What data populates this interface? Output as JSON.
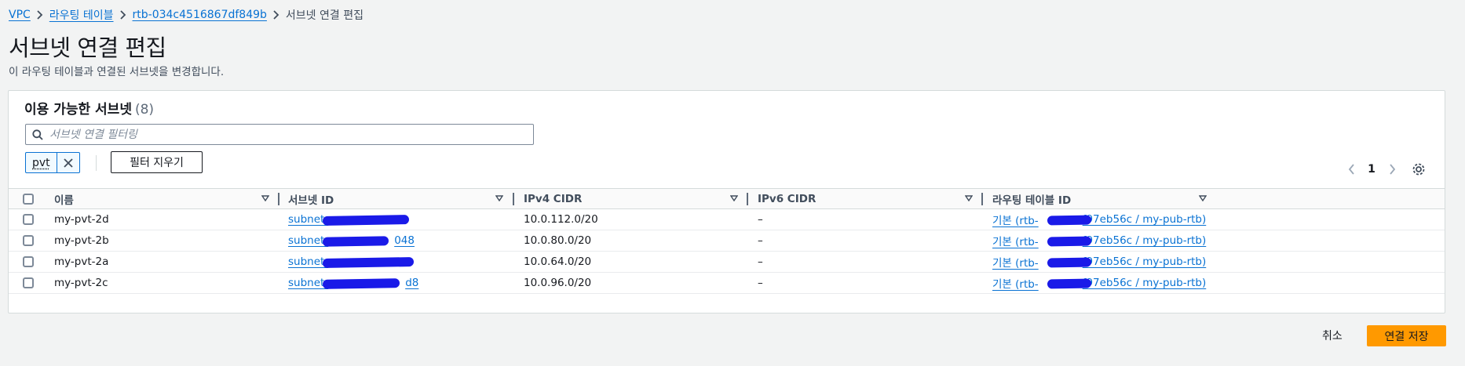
{
  "breadcrumb": {
    "items": [
      {
        "label": "VPC"
      },
      {
        "label": "라우팅 테이블"
      },
      {
        "label": "rtb-034c4516867df849b"
      }
    ],
    "current": "서브넷 연결 편집"
  },
  "page": {
    "title": "서브넷 연결 편집",
    "description": "이 라우팅 테이블과 연결된 서브넷을 변경합니다."
  },
  "panel": {
    "title": "이용 가능한 서브넷",
    "count": "(8)",
    "search_placeholder": "서브넷 연결 필터링",
    "filter_token": "pvt",
    "clear_filter_label": "필터 지우기",
    "current_page": "1"
  },
  "table": {
    "columns": [
      "이름",
      "서브넷 ID",
      "IPv4 CIDR",
      "IPv6 CIDR",
      "라우팅 테이블 ID"
    ],
    "rows": [
      {
        "name": "my-pvt-2d",
        "subnet_prefix": "subnet-",
        "subnet_suffix": "",
        "ipv4": "10.0.112.0/20",
        "ipv6": "–",
        "rtb_prefix": "기본 (rtb-",
        "rtb_suffix": "f97eb56c / my-pub-rtb)"
      },
      {
        "name": "my-pvt-2b",
        "subnet_prefix": "subnet-",
        "subnet_suffix": "048",
        "ipv4": "10.0.80.0/20",
        "ipv6": "–",
        "rtb_prefix": "기본 (rtb-",
        "rtb_suffix": "f97eb56c / my-pub-rtb)"
      },
      {
        "name": "my-pvt-2a",
        "subnet_prefix": "subnet-",
        "subnet_suffix": "",
        "ipv4": "10.0.64.0/20",
        "ipv6": "–",
        "rtb_prefix": "기본 (rtb-",
        "rtb_suffix": "f97eb56c / my-pub-rtb)"
      },
      {
        "name": "my-pvt-2c",
        "subnet_prefix": "subnet-",
        "subnet_suffix": "d8",
        "ipv4": "10.0.96.0/20",
        "ipv6": "–",
        "rtb_prefix": "기본 (rtb-",
        "rtb_suffix": "f97eb56c / my-pub-rtb)"
      }
    ]
  },
  "footer": {
    "cancel_label": "취소",
    "save_label": "연결 저장"
  },
  "colors": {
    "link": "#0972d3",
    "primary_button": "#ff9900",
    "redaction": "#1a1ae8"
  }
}
